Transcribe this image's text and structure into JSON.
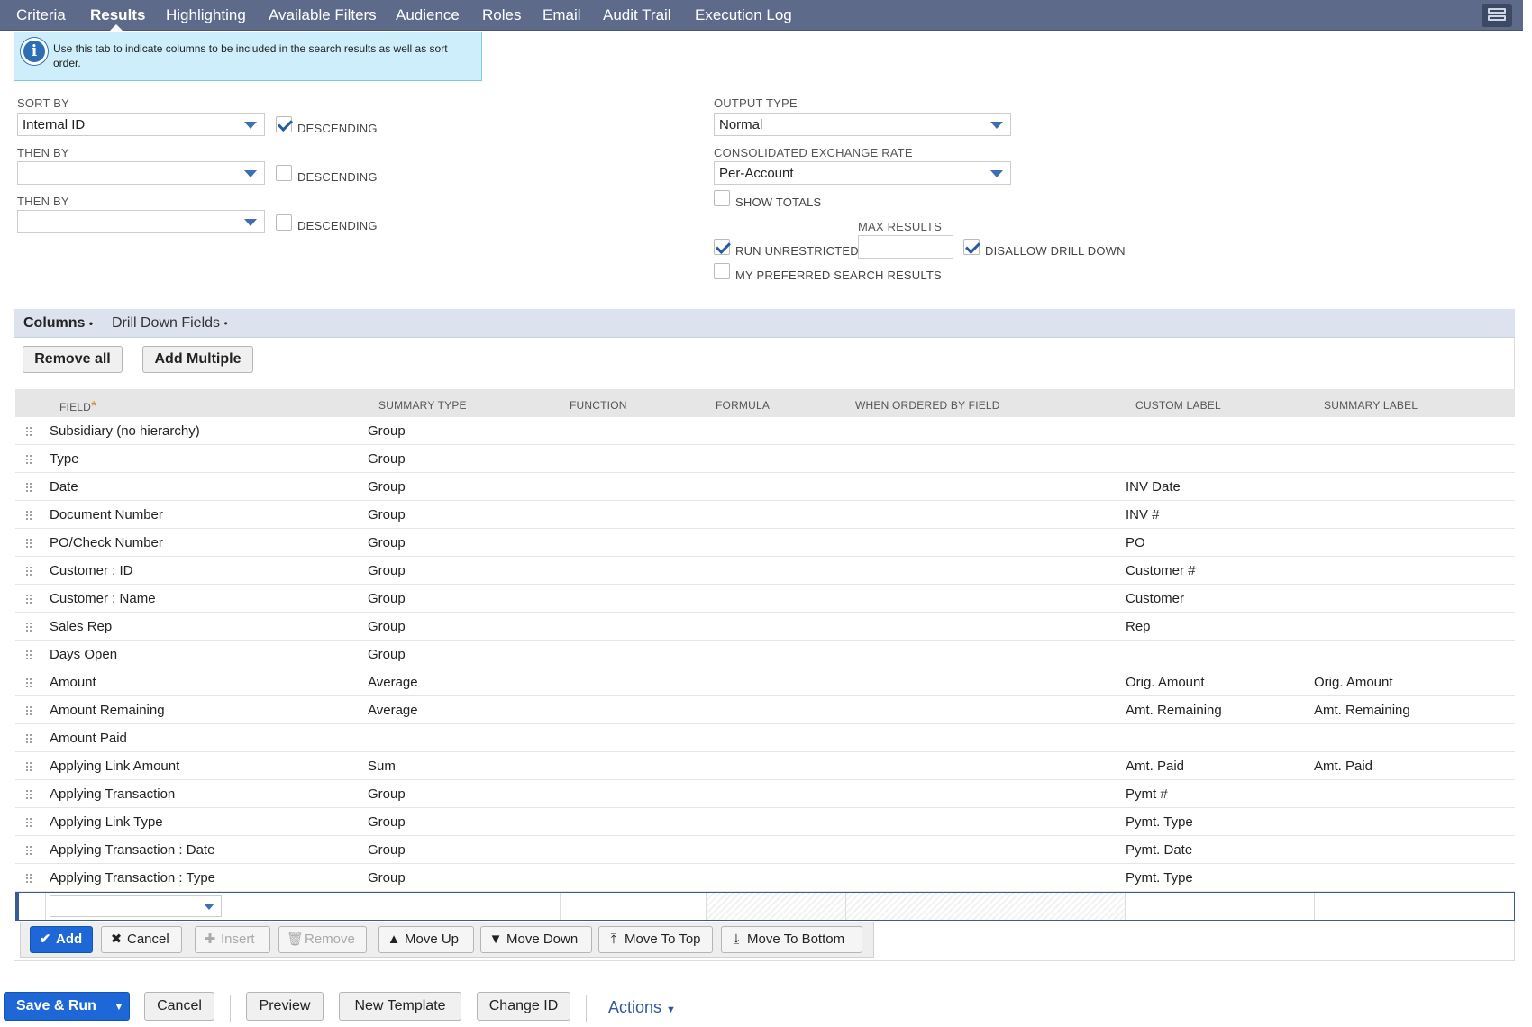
{
  "tabs": [
    {
      "label": "Criteria",
      "active": false
    },
    {
      "label": "Results",
      "active": true
    },
    {
      "label": "Highlighting",
      "active": false
    },
    {
      "label": "Available Filters",
      "active": false
    },
    {
      "label": "Audience",
      "active": false
    },
    {
      "label": "Roles",
      "active": false
    },
    {
      "label": "Email",
      "active": false
    },
    {
      "label": "Audit Trail",
      "active": false
    },
    {
      "label": "Execution Log",
      "active": false
    }
  ],
  "info": {
    "text": "Use this tab to indicate columns to be included in the search results as well as sort order."
  },
  "sort": {
    "sort_by_label": "SORT BY",
    "sort_by_value": "Internal ID",
    "sort_by_descending": true,
    "then_by_label": "THEN BY",
    "then_by_1_value": "",
    "then_by_1_descending": false,
    "then_by_2_value": "",
    "then_by_2_descending": false,
    "descending_label": "DESCENDING"
  },
  "output": {
    "output_type_label": "OUTPUT TYPE",
    "output_type_value": "Normal",
    "exchange_rate_label": "CONSOLIDATED EXCHANGE RATE",
    "exchange_rate_value": "Per-Account",
    "show_totals_label": "SHOW TOTALS",
    "show_totals": false,
    "max_results_label": "MAX RESULTS",
    "max_results_value": "",
    "run_unrestricted_label": "RUN UNRESTRICTED",
    "run_unrestricted": true,
    "disallow_drill_down_label": "DISALLOW DRILL DOWN",
    "disallow_drill_down": true,
    "preferred_label": "MY PREFERRED SEARCH RESULTS",
    "preferred": false
  },
  "subtabs": [
    {
      "label": "Columns",
      "dot": "•",
      "active": true
    },
    {
      "label": "Drill Down Fields",
      "dot": "•",
      "active": false
    }
  ],
  "column_buttons": {
    "remove_all": "Remove all",
    "add_multiple": "Add Multiple"
  },
  "table": {
    "headers": {
      "field": "FIELD",
      "field_required": "*",
      "summary_type": "SUMMARY TYPE",
      "function": "FUNCTION",
      "formula": "FORMULA",
      "when_ordered_by_field": "WHEN ORDERED BY FIELD",
      "custom_label": "CUSTOM LABEL",
      "summary_label": "SUMMARY LABEL"
    },
    "rows": [
      {
        "field": "Subsidiary (no hierarchy)",
        "summary_type": "Group",
        "custom_label": "",
        "summary_label": ""
      },
      {
        "field": "Type",
        "summary_type": "Group",
        "custom_label": "",
        "summary_label": ""
      },
      {
        "field": "Date",
        "summary_type": "Group",
        "custom_label": "INV Date",
        "summary_label": ""
      },
      {
        "field": "Document Number",
        "summary_type": "Group",
        "custom_label": "INV #",
        "summary_label": ""
      },
      {
        "field": "PO/Check Number",
        "summary_type": "Group",
        "custom_label": "PO",
        "summary_label": ""
      },
      {
        "field": "Customer : ID",
        "summary_type": "Group",
        "custom_label": "Customer #",
        "summary_label": ""
      },
      {
        "field": "Customer : Name",
        "summary_type": "Group",
        "custom_label": "Customer",
        "summary_label": ""
      },
      {
        "field": "Sales Rep",
        "summary_type": "Group",
        "custom_label": "Rep",
        "summary_label": ""
      },
      {
        "field": "Days Open",
        "summary_type": "Group",
        "custom_label": "",
        "summary_label": ""
      },
      {
        "field": "Amount",
        "summary_type": "Average",
        "custom_label": "Orig. Amount",
        "summary_label": "Orig. Amount"
      },
      {
        "field": "Amount Remaining",
        "summary_type": "Average",
        "custom_label": "Amt. Remaining",
        "summary_label": "Amt. Remaining"
      },
      {
        "field": "Amount Paid",
        "summary_type": "",
        "custom_label": "",
        "summary_label": ""
      },
      {
        "field": "Applying Link Amount",
        "summary_type": "Sum",
        "custom_label": "Amt. Paid",
        "summary_label": "Amt. Paid"
      },
      {
        "field": "Applying Transaction",
        "summary_type": "Group",
        "custom_label": "Pymt #",
        "summary_label": ""
      },
      {
        "field": "Applying Link Type",
        "summary_type": "Group",
        "custom_label": "Pymt. Type",
        "summary_label": ""
      },
      {
        "field": "Applying Transaction : Date",
        "summary_type": "Group",
        "custom_label": "Pymt. Date",
        "summary_label": ""
      },
      {
        "field": "Applying Transaction : Type",
        "summary_type": "Group",
        "custom_label": "Pymt. Type",
        "summary_label": ""
      }
    ]
  },
  "row_toolbar": {
    "add": "Add",
    "cancel": "Cancel",
    "insert": "Insert",
    "remove": "Remove",
    "move_up": "Move Up",
    "move_down": "Move Down",
    "move_to_top": "Move To Top",
    "move_to_bottom": "Move To Bottom"
  },
  "footer": {
    "save_run": "Save & Run",
    "save_run_dropdown": "▼",
    "cancel": "Cancel",
    "preview": "Preview",
    "new_template": "New Template",
    "change_id": "Change ID",
    "actions": "Actions"
  },
  "colors": {
    "tab_bar": "#5d6a8a",
    "primary_button": "#1e67d6",
    "info_background": "#cdeefa",
    "link": "#2c5aa0"
  }
}
